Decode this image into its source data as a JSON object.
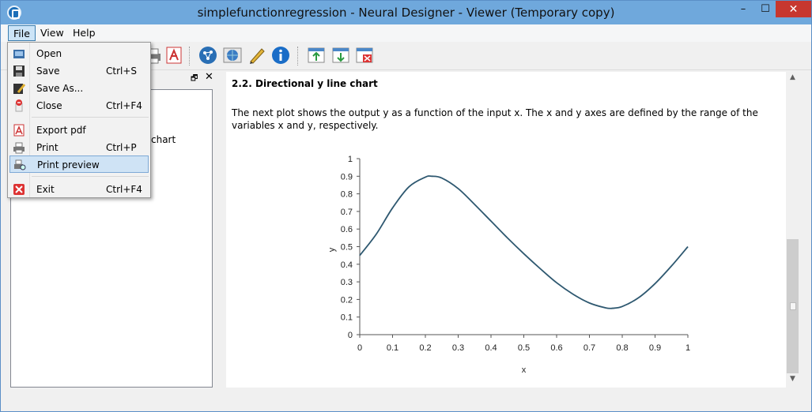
{
  "window": {
    "title": "simplefunctionregression - Neural Designer - Viewer (Temporary copy)",
    "minimize": "–",
    "maximize": "☐",
    "close": "✕"
  },
  "menubar": {
    "file": "File",
    "view": "View",
    "help": "Help"
  },
  "file_menu": {
    "items": [
      {
        "label": "Open",
        "shortcut": ""
      },
      {
        "label": "Save",
        "shortcut": "Ctrl+S"
      },
      {
        "label": "Save As...",
        "shortcut": ""
      },
      {
        "label": "Close",
        "shortcut": "Ctrl+F4"
      },
      {
        "label": "Export pdf",
        "shortcut": ""
      },
      {
        "label": "Print",
        "shortcut": "Ctrl+P"
      },
      {
        "label": "Print preview",
        "shortcut": ""
      },
      {
        "label": "Exit",
        "shortcut": "Ctrl+F4"
      }
    ]
  },
  "left_pane": {
    "float_icon": "🗗",
    "close_icon": "✕",
    "tree_text": "chart"
  },
  "content": {
    "section_title": "2.2. Directional y line chart",
    "description": "The next plot shows the output y as a function of the input x. The x and y axes are defined by the range of the variables x and y, respectively."
  },
  "scrollbar": {
    "up": "▲",
    "down": "▼"
  },
  "colors": {
    "accent": "#6fa8dc",
    "line": "#2e5870",
    "menu_highlight": "#cfe3f5"
  },
  "icons": [
    "open-icon",
    "save-icon",
    "save-as-icon",
    "close-file-icon",
    "pdf-icon",
    "print-icon",
    "print-preview-icon",
    "exit-icon"
  ],
  "chart_data": {
    "type": "line",
    "title": "",
    "xlabel": "x",
    "ylabel": "y",
    "xlim": [
      0,
      1
    ],
    "ylim": [
      0,
      1
    ],
    "xticks": [
      "0",
      "0.1",
      "0.2",
      "0.3",
      "0.4",
      "0.5",
      "0.6",
      "0.7",
      "0.8",
      "0.9",
      "1"
    ],
    "yticks": [
      "0",
      "0.1",
      "0.2",
      "0.3",
      "0.4",
      "0.5",
      "0.6",
      "0.7",
      "0.8",
      "0.9",
      "1"
    ],
    "grid": false,
    "series": [
      {
        "name": "",
        "x": [
          0,
          0.05,
          0.1,
          0.15,
          0.2,
          0.22,
          0.25,
          0.3,
          0.35,
          0.4,
          0.45,
          0.5,
          0.55,
          0.6,
          0.65,
          0.7,
          0.75,
          0.77,
          0.8,
          0.85,
          0.9,
          0.95,
          1.0
        ],
        "y": [
          0.45,
          0.57,
          0.72,
          0.84,
          0.895,
          0.9,
          0.89,
          0.83,
          0.74,
          0.645,
          0.55,
          0.46,
          0.375,
          0.295,
          0.23,
          0.18,
          0.152,
          0.15,
          0.16,
          0.21,
          0.29,
          0.39,
          0.5
        ]
      }
    ]
  }
}
